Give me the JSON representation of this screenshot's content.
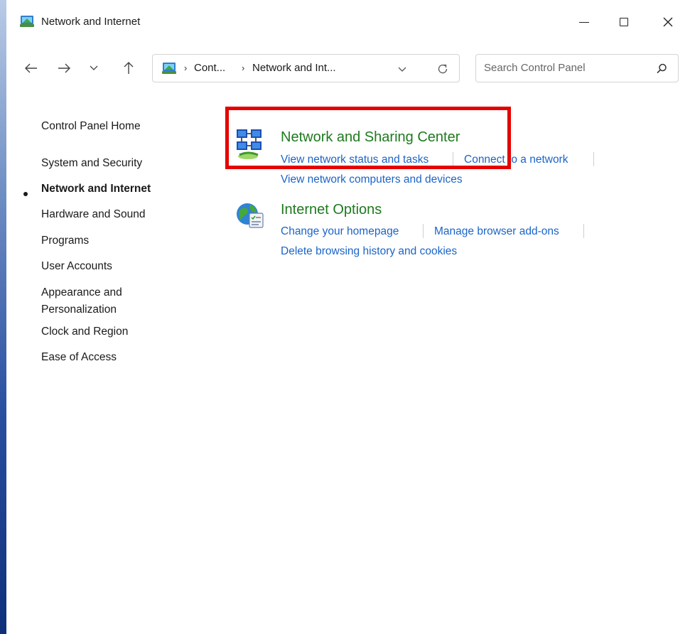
{
  "window": {
    "title": "Network and Internet"
  },
  "navigation": {
    "breadcrumb": [
      "Cont...",
      "Network and Int..."
    ],
    "search_placeholder": "Search Control Panel"
  },
  "sidebar": {
    "items": [
      {
        "label": "Control Panel Home",
        "active": false
      },
      {
        "label": "System and Security",
        "active": false
      },
      {
        "label": "Network and Internet",
        "active": true
      },
      {
        "label": "Hardware and Sound",
        "active": false
      },
      {
        "label": "Programs",
        "active": false
      },
      {
        "label": "User Accounts",
        "active": false
      },
      {
        "label": "Appearance and",
        "active": false
      },
      {
        "label": "Personalization",
        "active": false
      },
      {
        "label": "Clock and Region",
        "active": false
      },
      {
        "label": "Ease of Access",
        "active": false
      }
    ]
  },
  "categories": [
    {
      "title": "Network and Sharing Center",
      "links": [
        "View network status and tasks",
        "Connect to a network",
        "View network computers and devices"
      ]
    },
    {
      "title": "Internet Options",
      "links": [
        "Change your homepage",
        "Manage browser add-ons",
        "Delete browsing history and cookies"
      ]
    }
  ],
  "colors": {
    "category_title": "#1e7a1e",
    "link": "#1a64c8",
    "highlight": "#e60000"
  },
  "icons": {
    "app": "control-panel-network-icon",
    "network_sharing": "network-sharing-center-icon",
    "internet_options": "internet-options-globe-icon"
  }
}
